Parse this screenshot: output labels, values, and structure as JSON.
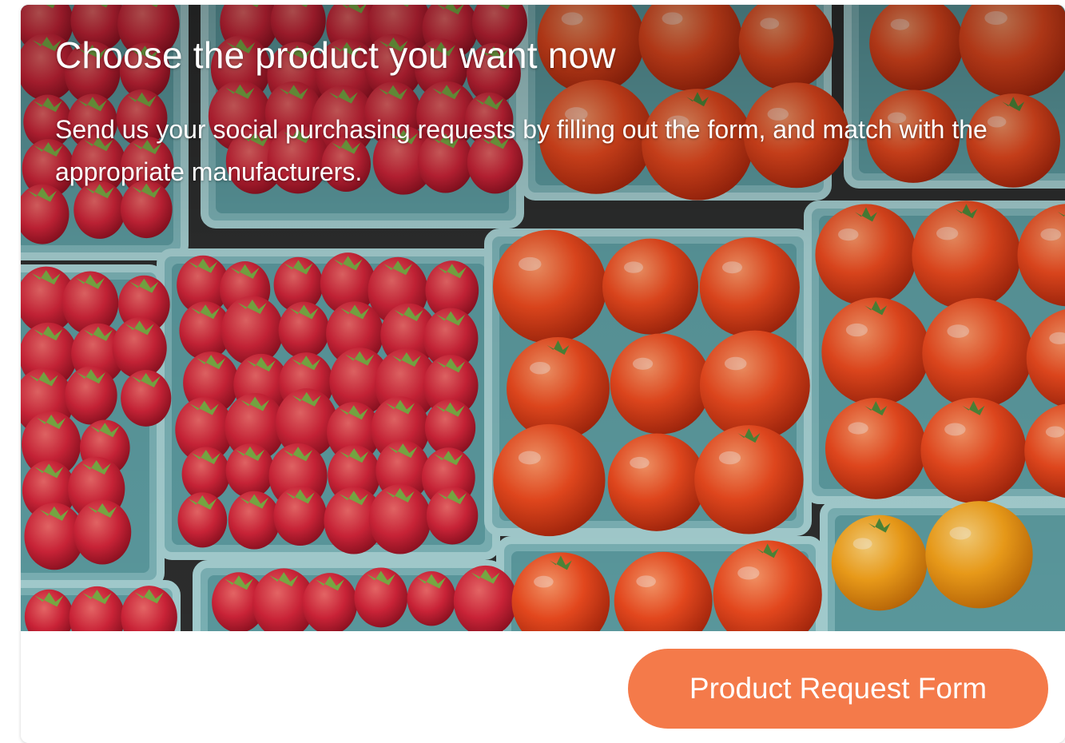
{
  "hero": {
    "title": "Choose the product you want now",
    "subtitle": "Send us your social purchasing requests by filling out the form, and match with the appropriate manufacturers.",
    "image_subject": "produce-photo"
  },
  "cta": {
    "label": "Product Request Form",
    "color": "#f47a4a"
  }
}
